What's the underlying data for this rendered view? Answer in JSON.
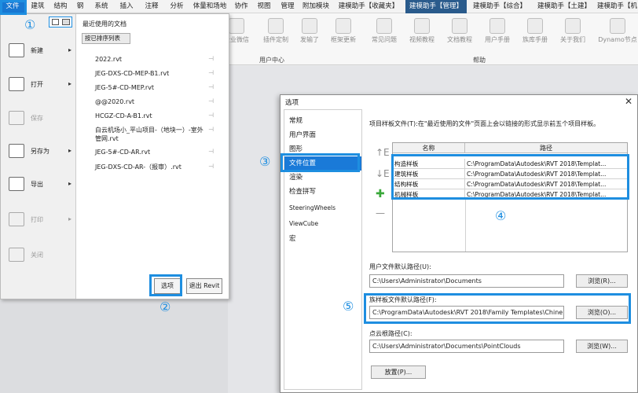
{
  "menubar": {
    "tabs": [
      "文件",
      "建筑",
      "结构",
      "钢",
      "系统",
      "插入",
      "注释",
      "分析",
      "体量和场地",
      "协作",
      "视图",
      "管理",
      "附加模块",
      "建模助手【收藏夹】",
      "建模助手【管理】",
      "建模助手【综合】",
      "建模助手【土建】",
      "建模助手【机电】"
    ]
  },
  "ribbon": {
    "buttons": [
      "企业微信",
      "插件定制",
      "发输了",
      "框架更新",
      "常见问题",
      "视频教程",
      "文档教程",
      "用户手册",
      "族库手册",
      "关于我们",
      "Dynamo节点"
    ],
    "groups": [
      "用户中心",
      "帮助"
    ]
  },
  "file_menu": {
    "recent_title": "最近使用的文档",
    "sort": "按已排序列表",
    "items": [
      {
        "label": "新建",
        "arrow": "▸"
      },
      {
        "label": "打开",
        "arrow": "▸"
      },
      {
        "label": "保存",
        "arrow": ""
      },
      {
        "label": "另存为",
        "arrow": "▸"
      },
      {
        "label": "导出",
        "arrow": "▸"
      },
      {
        "label": "打印",
        "arrow": "▸"
      },
      {
        "label": "关闭",
        "arrow": ""
      }
    ],
    "recent": [
      "2022.rvt",
      "JEG-DXS-CD-MEP-B1.rvt",
      "JEG-5#-CD-MEP.rvt",
      "@@2020.rvt",
      "HCGZ-CD-A-B1.rvt",
      "白云机场小_平山项目-（地块一）-室外管网.rvt",
      "JEG-5#-CD-AR.rvt",
      "JEG-DXS-CD-AR-（报审）.rvt"
    ],
    "options_button": "选项",
    "exit_button": "退出 Revit"
  },
  "callouts": [
    "①",
    "②",
    "③",
    "④",
    "⑤"
  ],
  "dialog": {
    "title": "选项",
    "close": "✕",
    "nav": [
      "常规",
      "用户界面",
      "图形",
      "文件位置",
      "渲染",
      "检查拼写",
      "SteeringWheels",
      "ViewCube",
      "宏"
    ],
    "description": "项目样板文件(T):在\"最近使用的文件\"页面上会以链接的形式显示前五个项目样板。",
    "table_headers": [
      "名称",
      "路径"
    ],
    "templates": [
      {
        "name": "构造样板",
        "path": "C:\\ProgramData\\Autodesk\\RVT 2018\\Templat..."
      },
      {
        "name": "建筑样板",
        "path": "C:\\ProgramData\\Autodesk\\RVT 2018\\Templat..."
      },
      {
        "name": "结构样板",
        "path": "C:\\ProgramData\\Autodesk\\RVT 2018\\Templat..."
      },
      {
        "name": "机械样板",
        "path": "C:\\ProgramData\\Autodesk\\RVT 2018\\Templat..."
      }
    ],
    "side_icons": [
      "↑E",
      "↓E",
      "✚",
      "—"
    ],
    "user_path_label": "用户文件默认路径(U):",
    "user_path": "C:\\Users\\Administrator\\Documents",
    "family_path_label": "族样板文件默认路径(F):",
    "family_path": "C:\\ProgramData\\Autodesk\\RVT 2018\\Family Templates\\Chine",
    "cloud_path_label": "点云根路径(C):",
    "cloud_path": "C:\\Users\\Administrator\\Documents\\PointClouds",
    "browse_r": "浏览(R)...",
    "browse_o": "浏览(O)...",
    "browse_w": "浏览(W)...",
    "places": "放置(P)..."
  }
}
